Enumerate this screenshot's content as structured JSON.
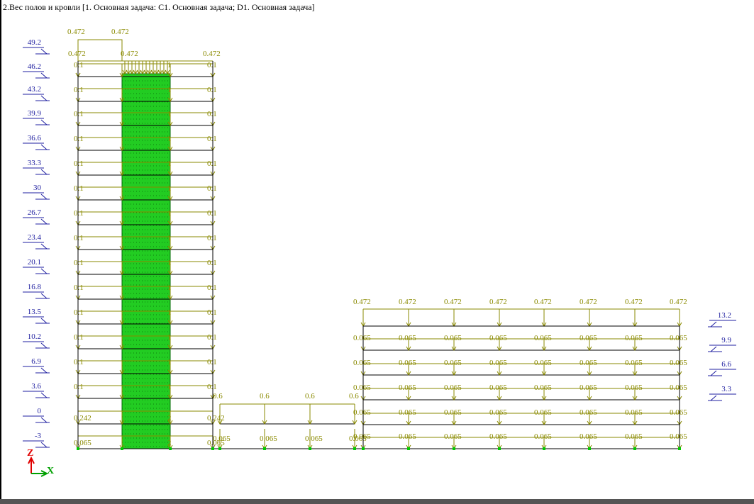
{
  "title": "2.Вес полов и кровли [1. Основная задача: C1. Основная задача; D1. Основная задача]",
  "axis": {
    "z": "Z",
    "x": "X"
  },
  "colors": {
    "load": "#8a8a00",
    "frame": "#000000",
    "level": "#1f1fa0",
    "node": "#00cc00",
    "axis_z": "#e00000",
    "axis_x": "#00a000"
  },
  "levels_left": [
    "49.2",
    "46.2",
    "43.2",
    "39.9",
    "36.6",
    "33.3",
    "30",
    "26.7",
    "23.4",
    "20.1",
    "16.8",
    "13.5",
    "10.2",
    "6.9",
    "3.6",
    "0",
    "-3"
  ],
  "levels_right": [
    "13.2",
    "9.9",
    "6.6",
    "3.3"
  ],
  "loads": {
    "roof_tower": "0.472",
    "floor_tower": "0.1",
    "podium_low": "0.242",
    "basement": "0.065",
    "canopy": "0.6",
    "roof_annex": "0.472",
    "floor_annex": "0.065"
  }
}
